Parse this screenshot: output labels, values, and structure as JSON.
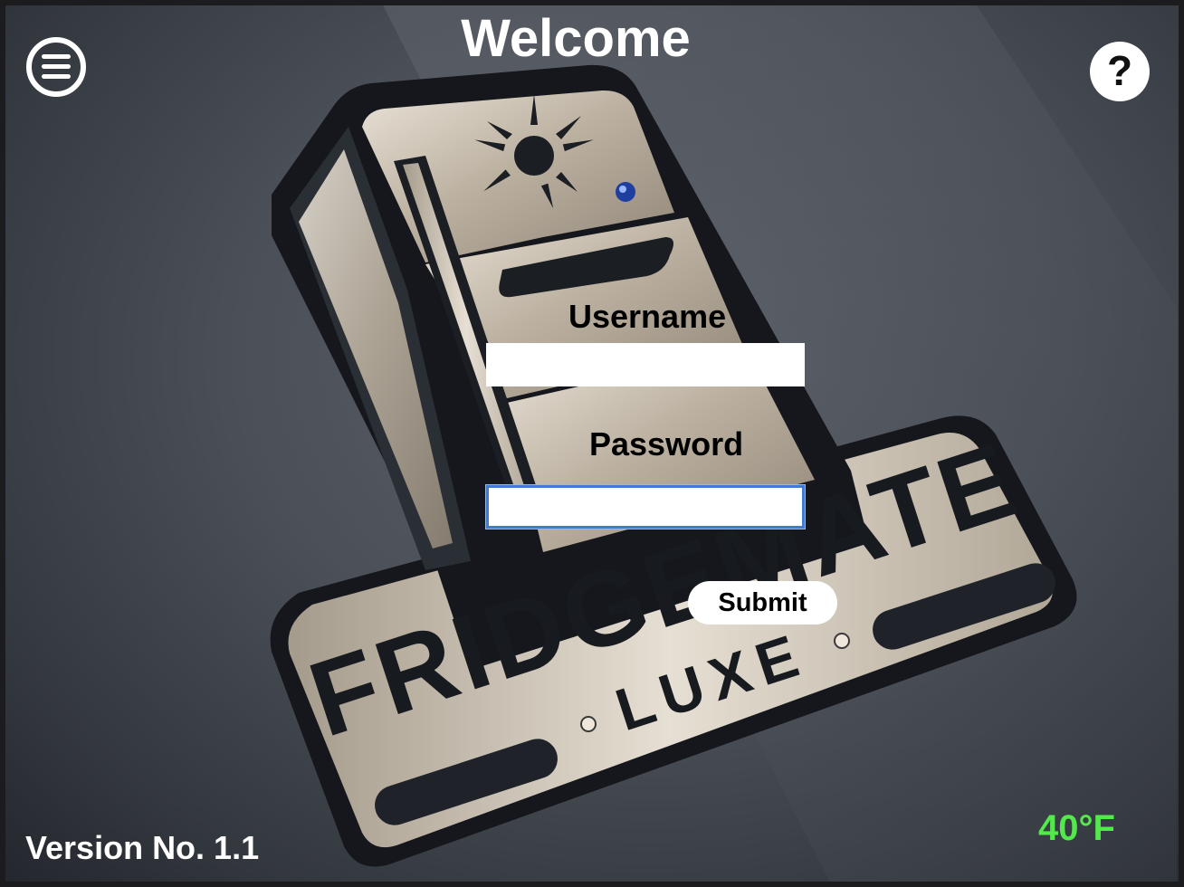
{
  "header": {
    "title": "Welcome"
  },
  "logo": {
    "brand_text": "FRIDGEMATE",
    "brand_subtext": "LUXE"
  },
  "login_form": {
    "username_label": "Username",
    "username_value": "",
    "password_label": "Password",
    "password_value": "",
    "submit_label": "Submit"
  },
  "footer": {
    "version_text": "Version No. 1.1",
    "temperature": "40°F"
  },
  "icons": {
    "menu": "hamburger-menu-icon",
    "help": "help-question-icon"
  },
  "colors": {
    "background": "#4b4f57",
    "text_primary": "#ffffff",
    "field_focus_border": "#3f7bd4",
    "temperature_text": "#53e84b"
  }
}
